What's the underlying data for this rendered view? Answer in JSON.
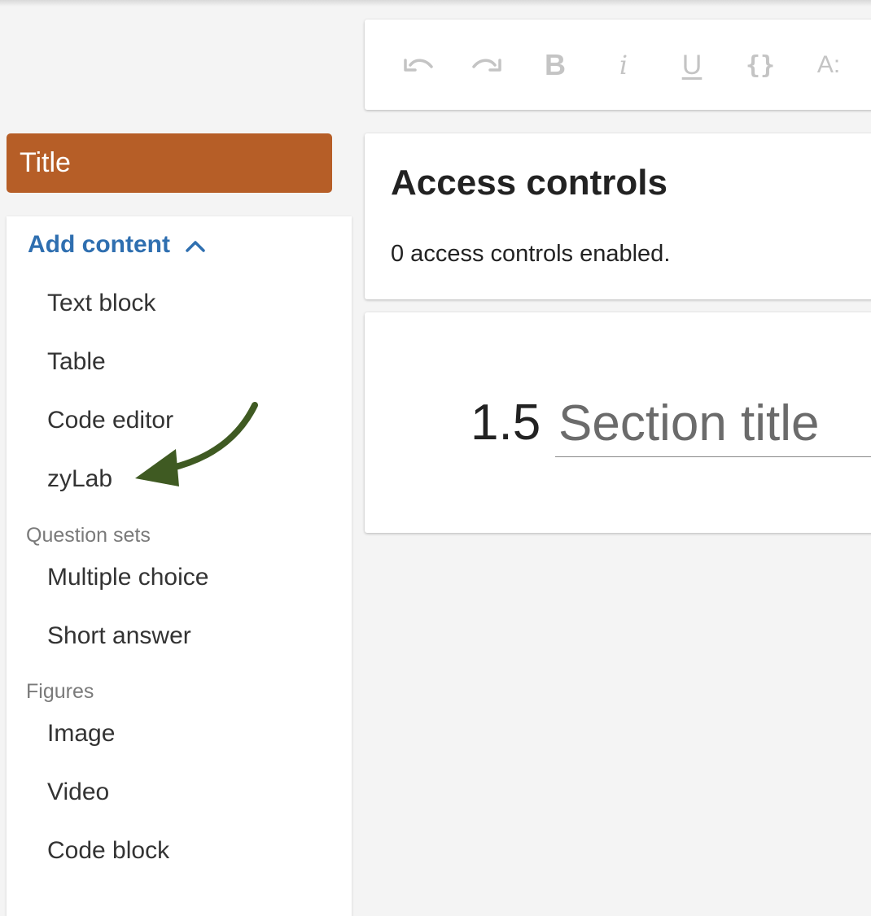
{
  "toolbar": {
    "tools": [
      "undo-icon",
      "redo-icon",
      "bold-icon",
      "italic-icon",
      "underline-icon",
      "code-braces-icon",
      "text-format-icon"
    ],
    "bold_glyph": "B",
    "italic_glyph": "i",
    "underline_glyph": "U",
    "braces_glyph": "{}",
    "format_glyph": "A:"
  },
  "title_bar": {
    "label": "Title",
    "color": "#b65e27"
  },
  "sidebar": {
    "add_content_label": "Add content",
    "accent_color": "#2f6fb0",
    "content_items": [
      "Text block",
      "Table",
      "Code editor",
      "zyLab"
    ],
    "question_sets_label": "Question sets",
    "question_items": [
      "Multiple choice",
      "Short answer"
    ],
    "figures_label": "Figures",
    "figure_items": [
      "Image",
      "Video",
      "Code block"
    ],
    "annotation": "arrow-pointing-to-zylab"
  },
  "access_controls": {
    "title": "Access controls",
    "status": "0 access controls enabled."
  },
  "section": {
    "number": "1.5",
    "title_placeholder": "Section title"
  }
}
